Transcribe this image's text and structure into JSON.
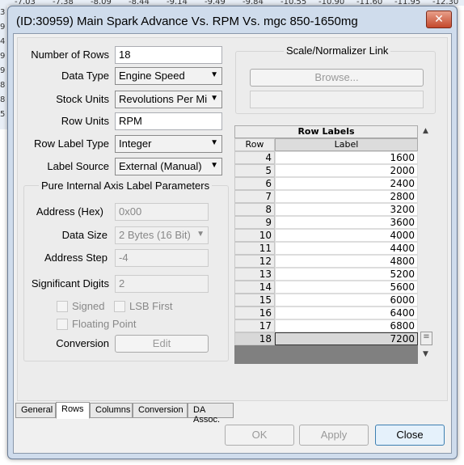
{
  "background": {
    "top_values": [
      "-7.03",
      "-7.38",
      "-8.09",
      "-8.44",
      "-9.14",
      "-9.49",
      "-9.84",
      "-10.55",
      "-10.90",
      "-11.60",
      "-11.95",
      "-12.30"
    ],
    "left_values": [
      "3",
      "9",
      "4",
      "9",
      "9",
      "8",
      "8",
      "5"
    ]
  },
  "window": {
    "title": "(ID:30959) Main Spark Advance Vs. RPM Vs. mgc 850-1650mg",
    "close_label": "✕"
  },
  "form": {
    "number_of_rows": {
      "label": "Number of Rows",
      "value": "18"
    },
    "data_type": {
      "label": "Data Type",
      "value": "Engine Speed"
    },
    "stock_units": {
      "label": "Stock Units",
      "value": "Revolutions Per Mi"
    },
    "row_units": {
      "label": "Row Units",
      "value": "RPM"
    },
    "row_label_type": {
      "label": "Row Label Type",
      "value": "Integer"
    },
    "label_source": {
      "label": "Label Source",
      "value": "External (Manual)"
    }
  },
  "internal": {
    "title": "Pure Internal Axis Label Parameters",
    "address": {
      "label": "Address (Hex)",
      "value": "0x00"
    },
    "data_size": {
      "label": "Data Size",
      "value": "2 Bytes (16 Bit)"
    },
    "address_step": {
      "label": "Address Step",
      "value": "-4"
    },
    "significant_digits": {
      "label": "Significant Digits",
      "value": "2"
    },
    "signed": "Signed",
    "lsb_first": "LSB First",
    "floating_point": "Floating Point",
    "conversion": {
      "label": "Conversion",
      "button": "Edit"
    }
  },
  "scale": {
    "title": "Scale/Normalizer Link",
    "browse": "Browse...",
    "value": ""
  },
  "row_labels": {
    "title": "Row Labels",
    "col_row": "Row",
    "col_label": "Label",
    "rows": [
      [
        "4",
        "1600"
      ],
      [
        "5",
        "2000"
      ],
      [
        "6",
        "2400"
      ],
      [
        "7",
        "2800"
      ],
      [
        "8",
        "3200"
      ],
      [
        "9",
        "3600"
      ],
      [
        "10",
        "4000"
      ],
      [
        "11",
        "4400"
      ],
      [
        "12",
        "4800"
      ],
      [
        "13",
        "5200"
      ],
      [
        "14",
        "5600"
      ],
      [
        "15",
        "6000"
      ],
      [
        "16",
        "6400"
      ],
      [
        "17",
        "6800"
      ],
      [
        "18",
        "7200"
      ]
    ],
    "selected_row": "18"
  },
  "tabs": [
    "General",
    "Rows",
    "Columns",
    "Conversion",
    "DA Assoc."
  ],
  "active_tab": "Rows",
  "buttons": {
    "ok": "OK",
    "apply": "Apply",
    "close": "Close"
  }
}
